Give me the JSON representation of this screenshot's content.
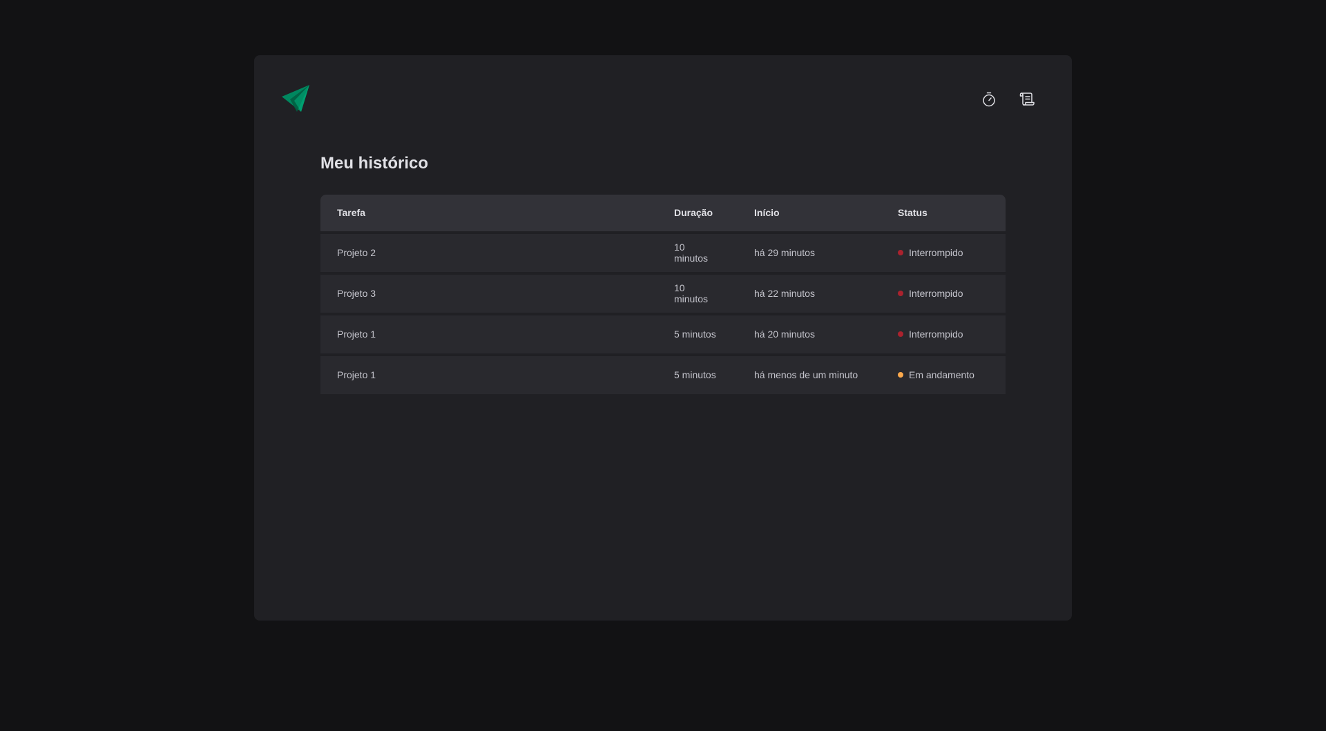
{
  "colors": {
    "background": "#121214",
    "panel": "#202024",
    "header_row": "#323238",
    "row": "#29292e",
    "brand": "#00875f",
    "status_interrupted": "#ab222e",
    "status_in_progress": "#fba94c"
  },
  "nav": {
    "items": [
      {
        "icon": "timer-icon"
      },
      {
        "icon": "scroll-icon"
      }
    ]
  },
  "page": {
    "title": "Meu histórico"
  },
  "table": {
    "headers": {
      "task": "Tarefa",
      "duration": "Duração",
      "start": "Início",
      "status": "Status"
    },
    "rows": [
      {
        "task": "Projeto 2",
        "duration": "10 minutos",
        "start": "há 29 minutos",
        "status": "Interrompido",
        "status_color": "#ab222e"
      },
      {
        "task": "Projeto 3",
        "duration": "10 minutos",
        "start": "há 22 minutos",
        "status": "Interrompido",
        "status_color": "#ab222e"
      },
      {
        "task": "Projeto 1",
        "duration": "5 minutos",
        "start": "há 20 minutos",
        "status": "Interrompido",
        "status_color": "#ab222e"
      },
      {
        "task": "Projeto 1",
        "duration": "5 minutos",
        "start": "há menos de um minuto",
        "status": "Em andamento",
        "status_color": "#fba94c"
      }
    ]
  }
}
